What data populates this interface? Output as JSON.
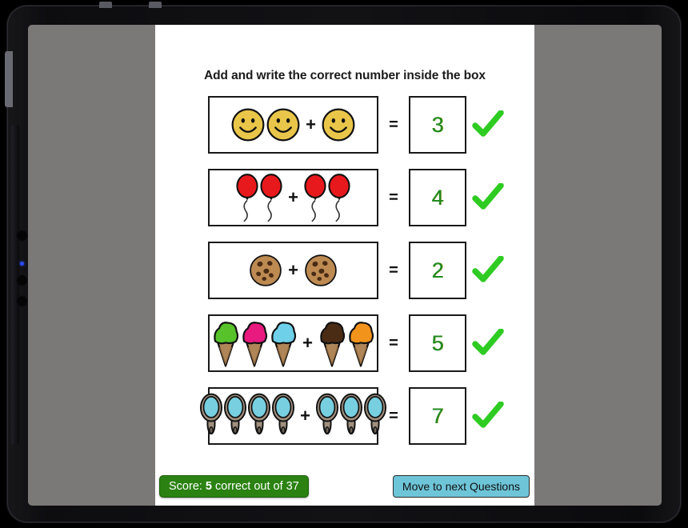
{
  "device": {
    "type": "tablet",
    "bezel_color": "#111114",
    "screen_background": "#7b7878",
    "page_background": "#ffffff"
  },
  "worksheet": {
    "title": "Add and write the correct number inside the box",
    "plus_symbol": "+",
    "equals_symbol": "=",
    "answer_color": "#1f8a1f",
    "check_color": "#2ecc22",
    "problems": [
      {
        "id": "problem-1",
        "object": "smiley-face",
        "left_count": 2,
        "right_count": 1,
        "answer": "3",
        "correct": true
      },
      {
        "id": "problem-2",
        "object": "balloon",
        "left_count": 2,
        "right_count": 2,
        "answer": "4",
        "correct": true
      },
      {
        "id": "problem-3",
        "object": "cookie",
        "left_count": 1,
        "right_count": 1,
        "answer": "2",
        "correct": true
      },
      {
        "id": "problem-4",
        "object": "ice-cream-cone",
        "left_count": 3,
        "right_count": 2,
        "answer": "5",
        "correct": true,
        "scoop_colors": [
          "#57c22a",
          "#e8197f",
          "#6fd0ea",
          "#4a2c14",
          "#f2931c"
        ]
      },
      {
        "id": "problem-5",
        "object": "hand-mirror",
        "left_count": 4,
        "right_count": 3,
        "answer": "7",
        "correct": true
      }
    ]
  },
  "footer": {
    "score_prefix": "Score:",
    "score_value": "5",
    "score_suffix": "correct out of 37",
    "score_badge_color": "#2b8212",
    "next_button_label": "Move to next Questions",
    "next_button_color": "#6ec5d8"
  }
}
